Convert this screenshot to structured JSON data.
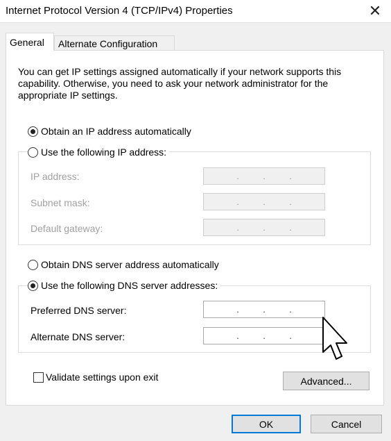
{
  "window": {
    "title": "Internet Protocol Version 4 (TCP/IPv4) Properties",
    "close_icon": "close-icon"
  },
  "tabs": [
    {
      "label": "General",
      "active": true
    },
    {
      "label": "Alternate Configuration",
      "active": false
    }
  ],
  "general": {
    "intro": "You can get IP settings assigned automatically if your network supports this capability. Otherwise, you need to ask your network administrator for the appropriate IP settings.",
    "ip_auto_label": "Obtain an IP address automatically",
    "ip_manual_label": "Use the following IP address:",
    "ip_fields": [
      {
        "label": "IP address:",
        "value": ".    .    ."
      },
      {
        "label": "Subnet mask:",
        "value": ".    .    ."
      },
      {
        "label": "Default gateway:",
        "value": ".    .    ."
      }
    ],
    "dns_auto_label": "Obtain DNS server address automatically",
    "dns_manual_label": "Use the following DNS server addresses:",
    "dns_fields": [
      {
        "label": "Preferred DNS server:",
        "value": ".    .    ."
      },
      {
        "label": "Alternate DNS server:",
        "value": ".    .    ."
      }
    ],
    "validate_label": "Validate settings upon exit",
    "advanced_label": "Advanced..."
  },
  "footer": {
    "ok_label": "OK",
    "cancel_label": "Cancel"
  },
  "colors": {
    "accent": "#0078d7",
    "background": "#f0f0f0"
  }
}
